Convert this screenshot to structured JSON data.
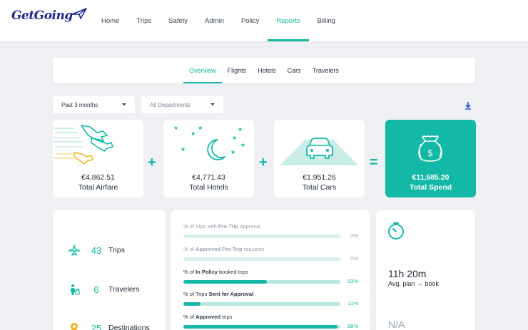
{
  "header": {
    "logo_text": "GetGoing",
    "nav": [
      {
        "label": "Home"
      },
      {
        "label": "Trips"
      },
      {
        "label": "Safety"
      },
      {
        "label": "Admin"
      },
      {
        "label": "Policy"
      },
      {
        "label": "Reports",
        "active": true
      },
      {
        "label": "Billing"
      }
    ]
  },
  "subtabs": [
    {
      "label": "Overview",
      "active": true
    },
    {
      "label": "Flights"
    },
    {
      "label": "Hotels"
    },
    {
      "label": "Cars"
    },
    {
      "label": "Travelers"
    }
  ],
  "filters": {
    "period": "Past 3 months",
    "department": "All Departments"
  },
  "stats": {
    "airfare": {
      "amount": "€4,862.51",
      "label": "Total Airfare"
    },
    "hotels": {
      "amount": "€4,771.43",
      "label": "Total Hotels"
    },
    "cars": {
      "amount": "€1,951.26",
      "label": "Total Cars"
    },
    "total": {
      "amount": "€11,585.20",
      "label": "Total Spend"
    }
  },
  "operators": {
    "plus": "+",
    "equals": "="
  },
  "counts": [
    {
      "value": "43",
      "label": "Trips",
      "icon": "airplane-icon"
    },
    {
      "value": "6",
      "label": "Travelers",
      "icon": "travelers-icon"
    },
    {
      "value": "25",
      "label": "Destinations",
      "icon": "location-pin-icon"
    }
  ],
  "compliance": [
    {
      "pre": "% of trips with ",
      "bold": "Pre-Trip",
      "post": " approval",
      "pct": "0%",
      "value": 0,
      "faded": true
    },
    {
      "pre": "% of ",
      "bold": "Approved Pre-Trip",
      "post": " requests",
      "pct": "0%",
      "value": 0,
      "faded": true
    },
    {
      "pre": "% of ",
      "bold": "In Policy",
      "post": " booked trips",
      "pct": "53%",
      "value": 53,
      "faded": false
    },
    {
      "pre": "% of Trips ",
      "bold": "Sent for Approval",
      "post": "",
      "pct": "11%",
      "value": 11,
      "faded": false
    },
    {
      "pre": "% of ",
      "bold": "Approved",
      "post": " trips",
      "pct": "98%",
      "value": 98,
      "faded": false
    }
  ],
  "timing": {
    "avg_plan_value": "11h 20m",
    "avg_plan_label": "Avg. plan → book",
    "second_value": "N/A"
  },
  "colors": {
    "accent": "#14b8a6",
    "brand": "#1d2b8a"
  }
}
